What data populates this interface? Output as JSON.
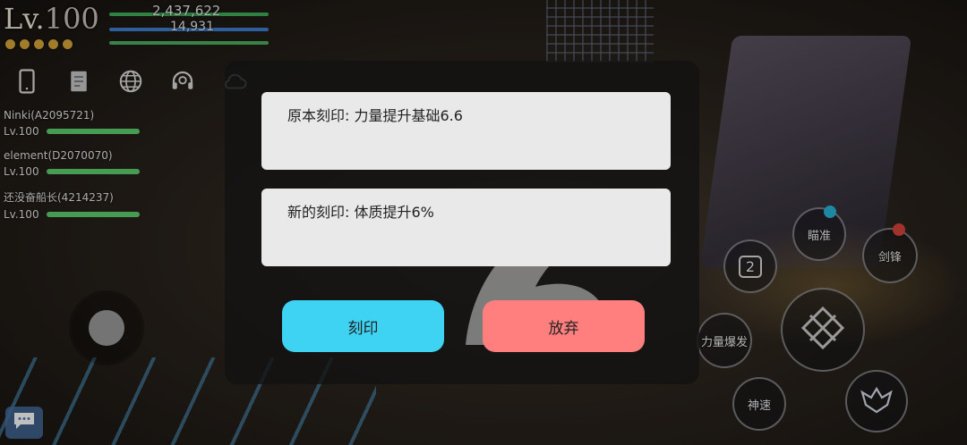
{
  "hud": {
    "level_prefix": "Lv.",
    "level": "100",
    "hp": "2,437,622",
    "mp": "14,931",
    "star_dots": 5
  },
  "hud_icons": [
    "phone-icon",
    "scroll-icon",
    "globe-icon",
    "headset-icon",
    "cloud-icon"
  ],
  "party": [
    {
      "name": "Ninki(A2095721)",
      "level": "Lv.100"
    },
    {
      "name": "element(D2070070)",
      "level": "Lv.100"
    },
    {
      "name": "还没奋船长(4214237)",
      "level": "Lv.100"
    }
  ],
  "skills": {
    "aim": "瞄准",
    "sword": "剑锋",
    "slot": "2",
    "power": "力量爆发",
    "speed": "神速"
  },
  "dialog": {
    "original_label": "原本刻印: 力量提升基础6.6",
    "new_label": "新的刻印: 体质提升6%",
    "imprint_button": "刻印",
    "abandon_button": "放弃"
  },
  "colors": {
    "imprint_button": "#3fd3f3",
    "abandon_button": "#ff7f7f",
    "hp_bar": "#3fae5b",
    "mp_bar": "#3b7fd0"
  }
}
